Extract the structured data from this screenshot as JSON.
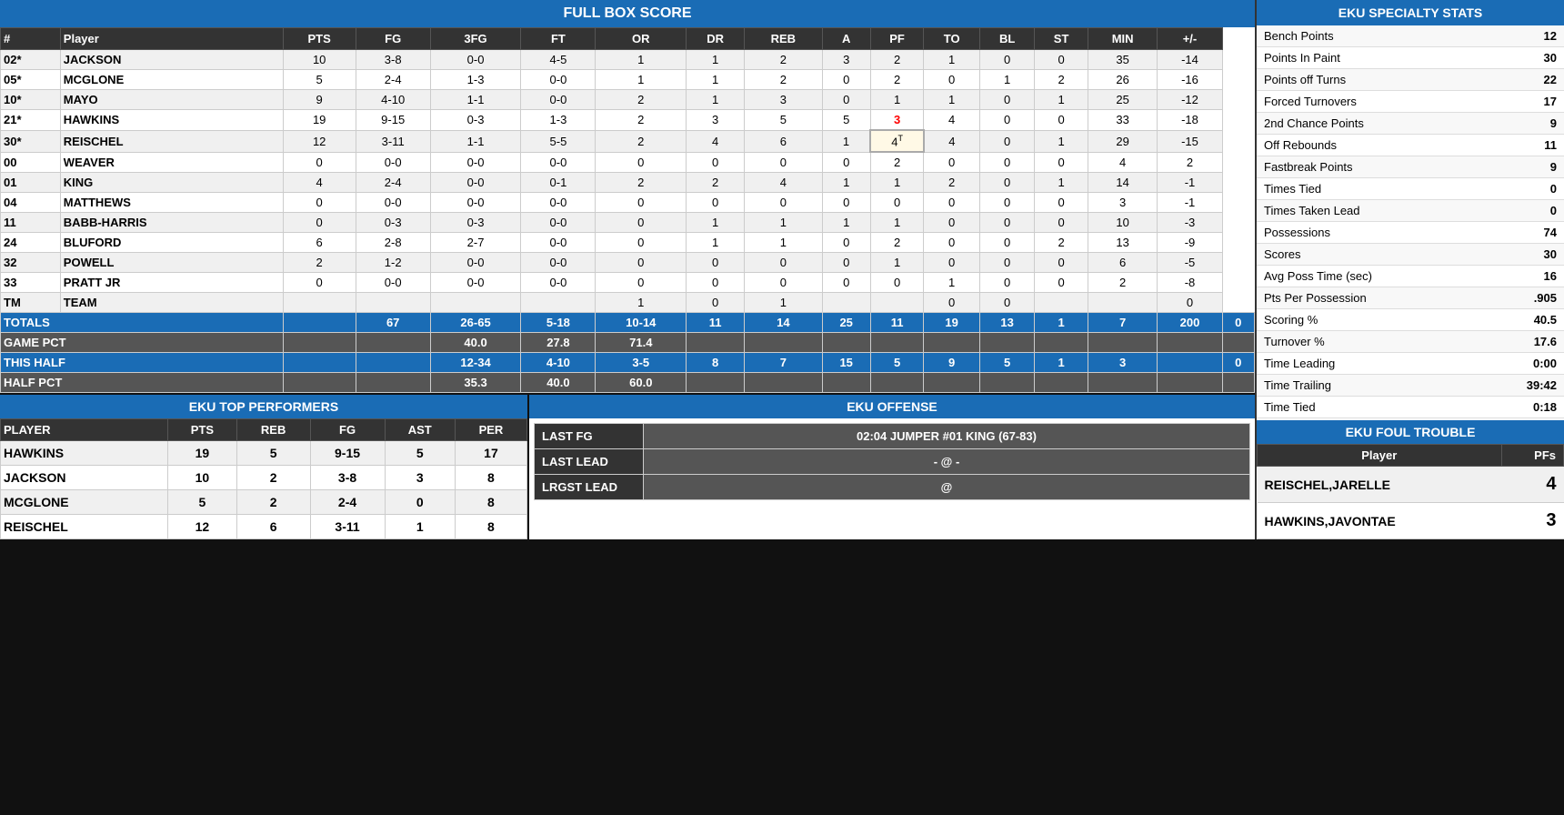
{
  "boxScore": {
    "title": "FULL BOX SCORE",
    "columns": [
      "#",
      "Player",
      "PTS",
      "FG",
      "3FG",
      "FT",
      "OR",
      "DR",
      "REB",
      "A",
      "PF",
      "TO",
      "BL",
      "ST",
      "MIN",
      "+/-"
    ],
    "rows": [
      {
        "num": "02*",
        "player": "JACKSON",
        "pts": "10",
        "fg": "3-8",
        "tfg": "0-0",
        "ft": "4-5",
        "or": "1",
        "dr": "1",
        "reb": "2",
        "a": "3",
        "pf": "2",
        "to": "1",
        "bl": "0",
        "st": "0",
        "min": "35",
        "pm": "-14",
        "pf_red": false,
        "pf_boxed": false
      },
      {
        "num": "05*",
        "player": "MCGLONE",
        "pts": "5",
        "fg": "2-4",
        "tfg": "1-3",
        "ft": "0-0",
        "or": "1",
        "dr": "1",
        "reb": "2",
        "a": "0",
        "pf": "2",
        "to": "0",
        "bl": "1",
        "st": "2",
        "min": "26",
        "pm": "-16",
        "pf_red": false,
        "pf_boxed": false
      },
      {
        "num": "10*",
        "player": "MAYO",
        "pts": "9",
        "fg": "4-10",
        "tfg": "1-1",
        "ft": "0-0",
        "or": "2",
        "dr": "1",
        "reb": "3",
        "a": "0",
        "pf": "1",
        "to": "1",
        "bl": "0",
        "st": "1",
        "min": "25",
        "pm": "-12",
        "pf_red": false,
        "pf_boxed": false
      },
      {
        "num": "21*",
        "player": "HAWKINS",
        "pts": "19",
        "fg": "9-15",
        "tfg": "0-3",
        "ft": "1-3",
        "or": "2",
        "dr": "3",
        "reb": "5",
        "a": "5",
        "pf": "3",
        "to": "4",
        "bl": "0",
        "st": "0",
        "min": "33",
        "pm": "-18",
        "pf_red": true,
        "pf_boxed": false
      },
      {
        "num": "30*",
        "player": "REISCHEL",
        "pts": "12",
        "fg": "3-11",
        "tfg": "1-1",
        "ft": "5-5",
        "or": "2",
        "dr": "4",
        "reb": "6",
        "a": "1",
        "pf": "4T",
        "to": "4",
        "bl": "0",
        "st": "1",
        "min": "29",
        "pm": "-15",
        "pf_red": false,
        "pf_boxed": true
      },
      {
        "num": "00",
        "player": "WEAVER",
        "pts": "0",
        "fg": "0-0",
        "tfg": "0-0",
        "ft": "0-0",
        "or": "0",
        "dr": "0",
        "reb": "0",
        "a": "0",
        "pf": "2",
        "to": "0",
        "bl": "0",
        "st": "0",
        "min": "4",
        "pm": "2",
        "pf_red": false,
        "pf_boxed": false
      },
      {
        "num": "01",
        "player": "KING",
        "pts": "4",
        "fg": "2-4",
        "tfg": "0-0",
        "ft": "0-1",
        "or": "2",
        "dr": "2",
        "reb": "4",
        "a": "1",
        "pf": "1",
        "to": "2",
        "bl": "0",
        "st": "1",
        "min": "14",
        "pm": "-1",
        "pf_red": false,
        "pf_boxed": false
      },
      {
        "num": "04",
        "player": "MATTHEWS",
        "pts": "0",
        "fg": "0-0",
        "tfg": "0-0",
        "ft": "0-0",
        "or": "0",
        "dr": "0",
        "reb": "0",
        "a": "0",
        "pf": "0",
        "to": "0",
        "bl": "0",
        "st": "0",
        "min": "3",
        "pm": "-1",
        "pf_red": false,
        "pf_boxed": false
      },
      {
        "num": "11",
        "player": "BABB-HARRIS",
        "pts": "0",
        "fg": "0-3",
        "tfg": "0-3",
        "ft": "0-0",
        "or": "0",
        "dr": "1",
        "reb": "1",
        "a": "1",
        "pf": "1",
        "to": "0",
        "bl": "0",
        "st": "0",
        "min": "10",
        "pm": "-3",
        "pf_red": false,
        "pf_boxed": false
      },
      {
        "num": "24",
        "player": "BLUFORD",
        "pts": "6",
        "fg": "2-8",
        "tfg": "2-7",
        "ft": "0-0",
        "or": "0",
        "dr": "1",
        "reb": "1",
        "a": "0",
        "pf": "2",
        "to": "0",
        "bl": "0",
        "st": "2",
        "min": "13",
        "pm": "-9",
        "pf_red": false,
        "pf_boxed": false
      },
      {
        "num": "32",
        "player": "POWELL",
        "pts": "2",
        "fg": "1-2",
        "tfg": "0-0",
        "ft": "0-0",
        "or": "0",
        "dr": "0",
        "reb": "0",
        "a": "0",
        "pf": "1",
        "to": "0",
        "bl": "0",
        "st": "0",
        "min": "6",
        "pm": "-5",
        "pf_red": false,
        "pf_boxed": false
      },
      {
        "num": "33",
        "player": "PRATT JR",
        "pts": "0",
        "fg": "0-0",
        "tfg": "0-0",
        "ft": "0-0",
        "or": "0",
        "dr": "0",
        "reb": "0",
        "a": "0",
        "pf": "0",
        "to": "1",
        "bl": "0",
        "st": "0",
        "min": "2",
        "pm": "-8",
        "pf_red": false,
        "pf_boxed": false
      },
      {
        "num": "TM",
        "player": "TEAM",
        "pts": "",
        "fg": "",
        "tfg": "",
        "ft": "",
        "or": "1",
        "dr": "0",
        "reb": "1",
        "a": "",
        "pf": "",
        "to": "0",
        "bl": "0",
        "st": "",
        "min": "",
        "pm": "0",
        "pf_red": false,
        "pf_boxed": false
      }
    ],
    "totals": {
      "label": "TOTALS",
      "pts": "67",
      "fg": "26-65",
      "tfg": "5-18",
      "ft": "10-14",
      "or": "11",
      "dr": "14",
      "reb": "25",
      "a": "11",
      "pf": "19",
      "to": "13",
      "bl": "1",
      "st": "7",
      "min": "200",
      "pm": "0"
    },
    "gamePct": {
      "label": "GAME PCT",
      "fg": "40.0",
      "tfg": "27.8",
      "ft": "71.4"
    },
    "thisHalf": {
      "label": "THIS HALF",
      "fg": "12-34",
      "tfg": "4-10",
      "ft": "3-5",
      "or": "8",
      "dr": "7",
      "reb": "15",
      "a": "5",
      "pf": "9",
      "to": "5",
      "bl": "1",
      "st": "3",
      "pm": "0"
    },
    "halfPct": {
      "label": "HALF PCT",
      "fg": "35.3",
      "tfg": "40.0",
      "ft": "60.0"
    }
  },
  "specialtyStats": {
    "title": "EKU SPECIALTY STATS",
    "rows": [
      {
        "label": "Bench Points",
        "value": "12"
      },
      {
        "label": "Points In Paint",
        "value": "30"
      },
      {
        "label": "Points off Turns",
        "value": "22"
      },
      {
        "label": "Forced Turnovers",
        "value": "17"
      },
      {
        "label": "2nd Chance Points",
        "value": "9"
      },
      {
        "label": "Off Rebounds",
        "value": "11"
      },
      {
        "label": "Fastbreak Points",
        "value": "9"
      },
      {
        "label": "Times Tied",
        "value": "0"
      },
      {
        "label": "Times Taken Lead",
        "value": "0"
      },
      {
        "label": "Possessions",
        "value": "74"
      },
      {
        "label": "Scores",
        "value": "30"
      },
      {
        "label": "Avg Poss Time (sec)",
        "value": "16"
      },
      {
        "label": "Pts Per Possession",
        "value": ".905"
      },
      {
        "label": "Scoring %",
        "value": "40.5"
      },
      {
        "label": "Turnover %",
        "value": "17.6"
      },
      {
        "label": "Time Leading",
        "value": "0:00"
      },
      {
        "label": "Time Trailing",
        "value": "39:42"
      },
      {
        "label": "Time Tied",
        "value": "0:18"
      }
    ]
  },
  "topPerformers": {
    "title": "EKU TOP PERFORMERS",
    "columns": [
      "PLAYER",
      "PTS",
      "REB",
      "FG",
      "AST",
      "PER"
    ],
    "rows": [
      {
        "player": "HAWKINS",
        "pts": "19",
        "reb": "5",
        "fg": "9-15",
        "ast": "5",
        "per": "17"
      },
      {
        "player": "JACKSON",
        "pts": "10",
        "reb": "2",
        "fg": "3-8",
        "ast": "3",
        "per": "8"
      },
      {
        "player": "MCGLONE",
        "pts": "5",
        "reb": "2",
        "fg": "2-4",
        "ast": "0",
        "per": "8"
      },
      {
        "player": "REISCHEL",
        "pts": "12",
        "reb": "6",
        "fg": "3-11",
        "ast": "1",
        "per": "8"
      }
    ]
  },
  "offense": {
    "title": "EKU OFFENSE",
    "rows": [
      {
        "label": "LAST FG",
        "value": "02:04 JUMPER #01 KING (67-83)"
      },
      {
        "label": "LAST LEAD",
        "value": "- @ -"
      },
      {
        "label": "LRGST LEAD",
        "value": "@"
      }
    ]
  },
  "foulTrouble": {
    "title": "EKU FOUL TROUBLE",
    "columns": [
      "Player",
      "PFs"
    ],
    "rows": [
      {
        "player": "REISCHEL,JARELLE",
        "pfs": "4"
      },
      {
        "player": "HAWKINS,JAVONTAE",
        "pfs": "3"
      }
    ]
  }
}
